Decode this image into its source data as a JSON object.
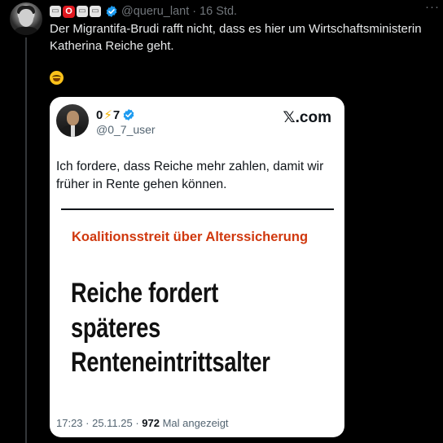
{
  "tweet": {
    "user_handle": "@queru_lant",
    "separator": "·",
    "time": "16 Std.",
    "more_label": "···",
    "name_emojis": [
      "light-emoji-icon",
      "red-o-emoji-icon",
      "light-emoji-icon",
      "light-emoji-icon"
    ],
    "red_emoji_char": "O",
    "verified": true,
    "text": "Der Migrantifa-Brudi rafft nicht, dass es hier um Wirtschaftsministerin Katherina Reiche geht.",
    "emoji": "rolling-on-floor-laughing-emoji-icon"
  },
  "quoted": {
    "name_part1": "0",
    "name_bolt": "⚡",
    "name_part2": "7",
    "handle": "@0_7_user",
    "brand": "𝕏.com",
    "text": "Ich fordere, dass Reiche mehr zahlen, damit wir früher in Rente gehen können.",
    "article": {
      "kicker": "Koalitionsstreit über Alterssicherung",
      "headline": "Reiche fordert späteres Renteneintrittsalter"
    },
    "footer": {
      "meta": "17:23 · 25.11.25 · ",
      "views": "972",
      "views_label": " Mal angezeigt"
    }
  },
  "colors": {
    "background": "#000000",
    "verified": "#1d9bf0",
    "kicker": "#d0380e"
  }
}
